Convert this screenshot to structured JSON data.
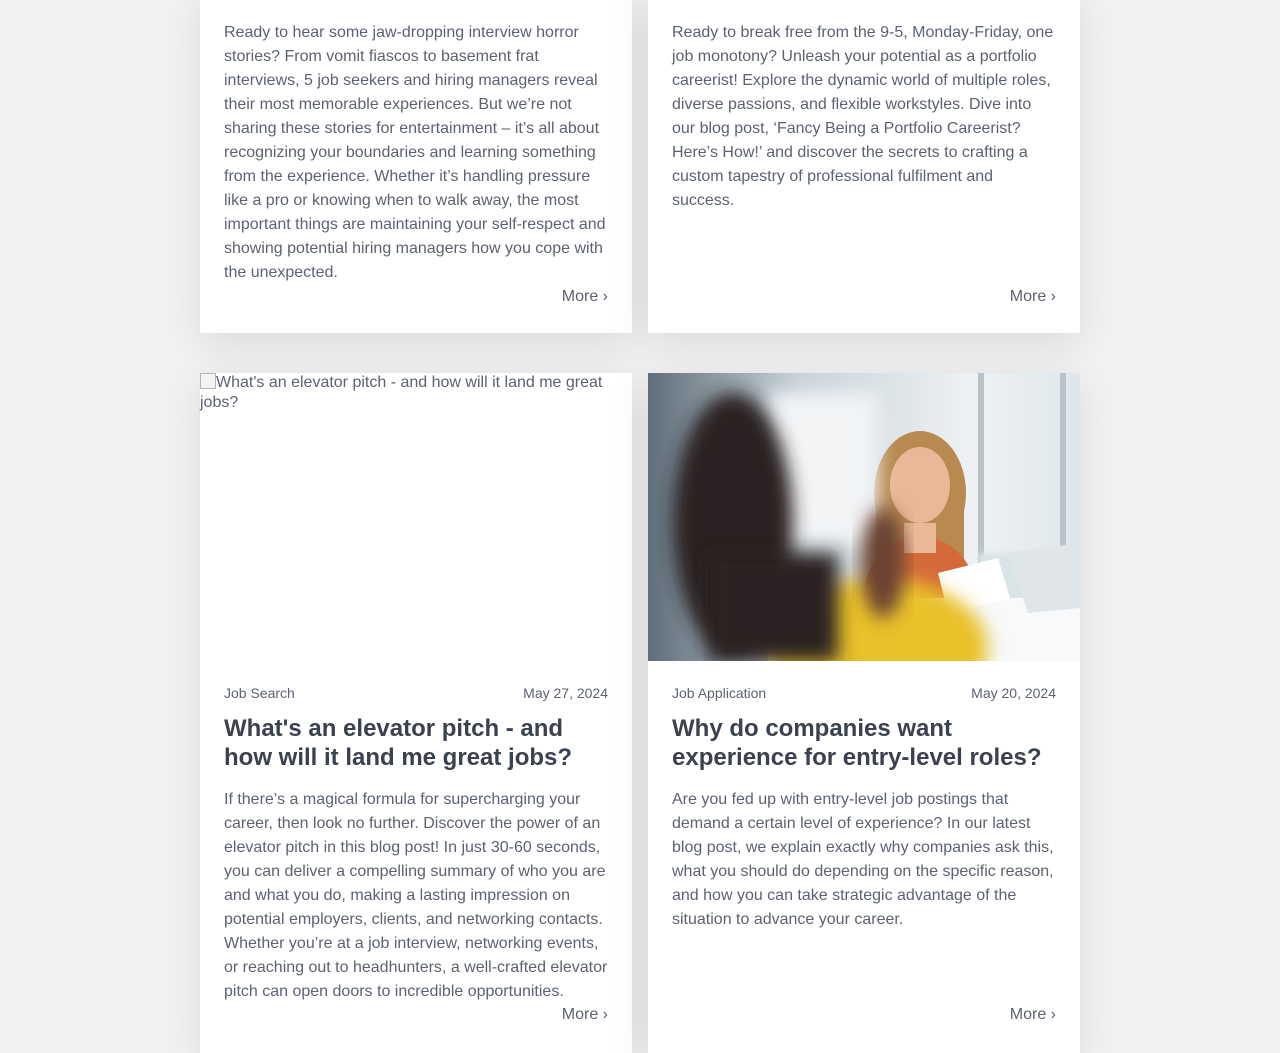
{
  "cards": [
    {
      "excerpt": "Ready to hear some jaw-dropping interview horror stories? From vomit fiascos to basement frat interviews, 5 job seekers and hiring managers reveal their most memorable experiences. But we’re not sharing these stories for entertainment – it’s all about recognizing your boundaries and learning something from the experience. Whether it’s handling pressure like a pro or knowing when to walk away, the most important things are maintaining your self-respect and showing potential hiring managers how you cope with the unexpected.",
      "more": "More ›"
    },
    {
      "excerpt": "Ready to break free from the 9-5, Monday-Friday, one job monotony? Unleash your potential as a portfolio careerist! Explore the dynamic world of multiple roles, diverse passions, and flexible workstyles. Dive into our blog post, ‘Fancy Being a Portfolio Careerist? Here’s How!’ and discover the secrets to crafting a custom tapestry of professional fulfilment and success.",
      "more": "More ›"
    },
    {
      "image_alt": "What's an elevator pitch - and how will it land me great jobs?",
      "category": "Job Search",
      "date": "May 27, 2024",
      "title": "What's an elevator pitch - and how will it land me great jobs?",
      "excerpt": "If there’s a magical formula for supercharging your career, then look no further. Discover the power of an elevator pitch in this blog post! In just 30-60 seconds, you can deliver a compelling summary of who you are and what you do, making a lasting impression on potential employers, clients, and networking contacts. Whether you’re at a job interview, networking events, or reaching out to headhunters, a well-crafted elevator pitch can open doors to incredible opportunities.",
      "more": "More ›"
    },
    {
      "category": "Job Application",
      "date": "May 20, 2024",
      "title": "Why do companies want experience for entry-level roles?",
      "excerpt": "Are you fed up with entry-level job postings that demand a certain level of experience? In our latest blog post, we explain exactly why companies ask this, what you should do depending on the specific reason, and how you can take strategic advantage of the situation to advance your career.",
      "more": "More ›"
    }
  ]
}
